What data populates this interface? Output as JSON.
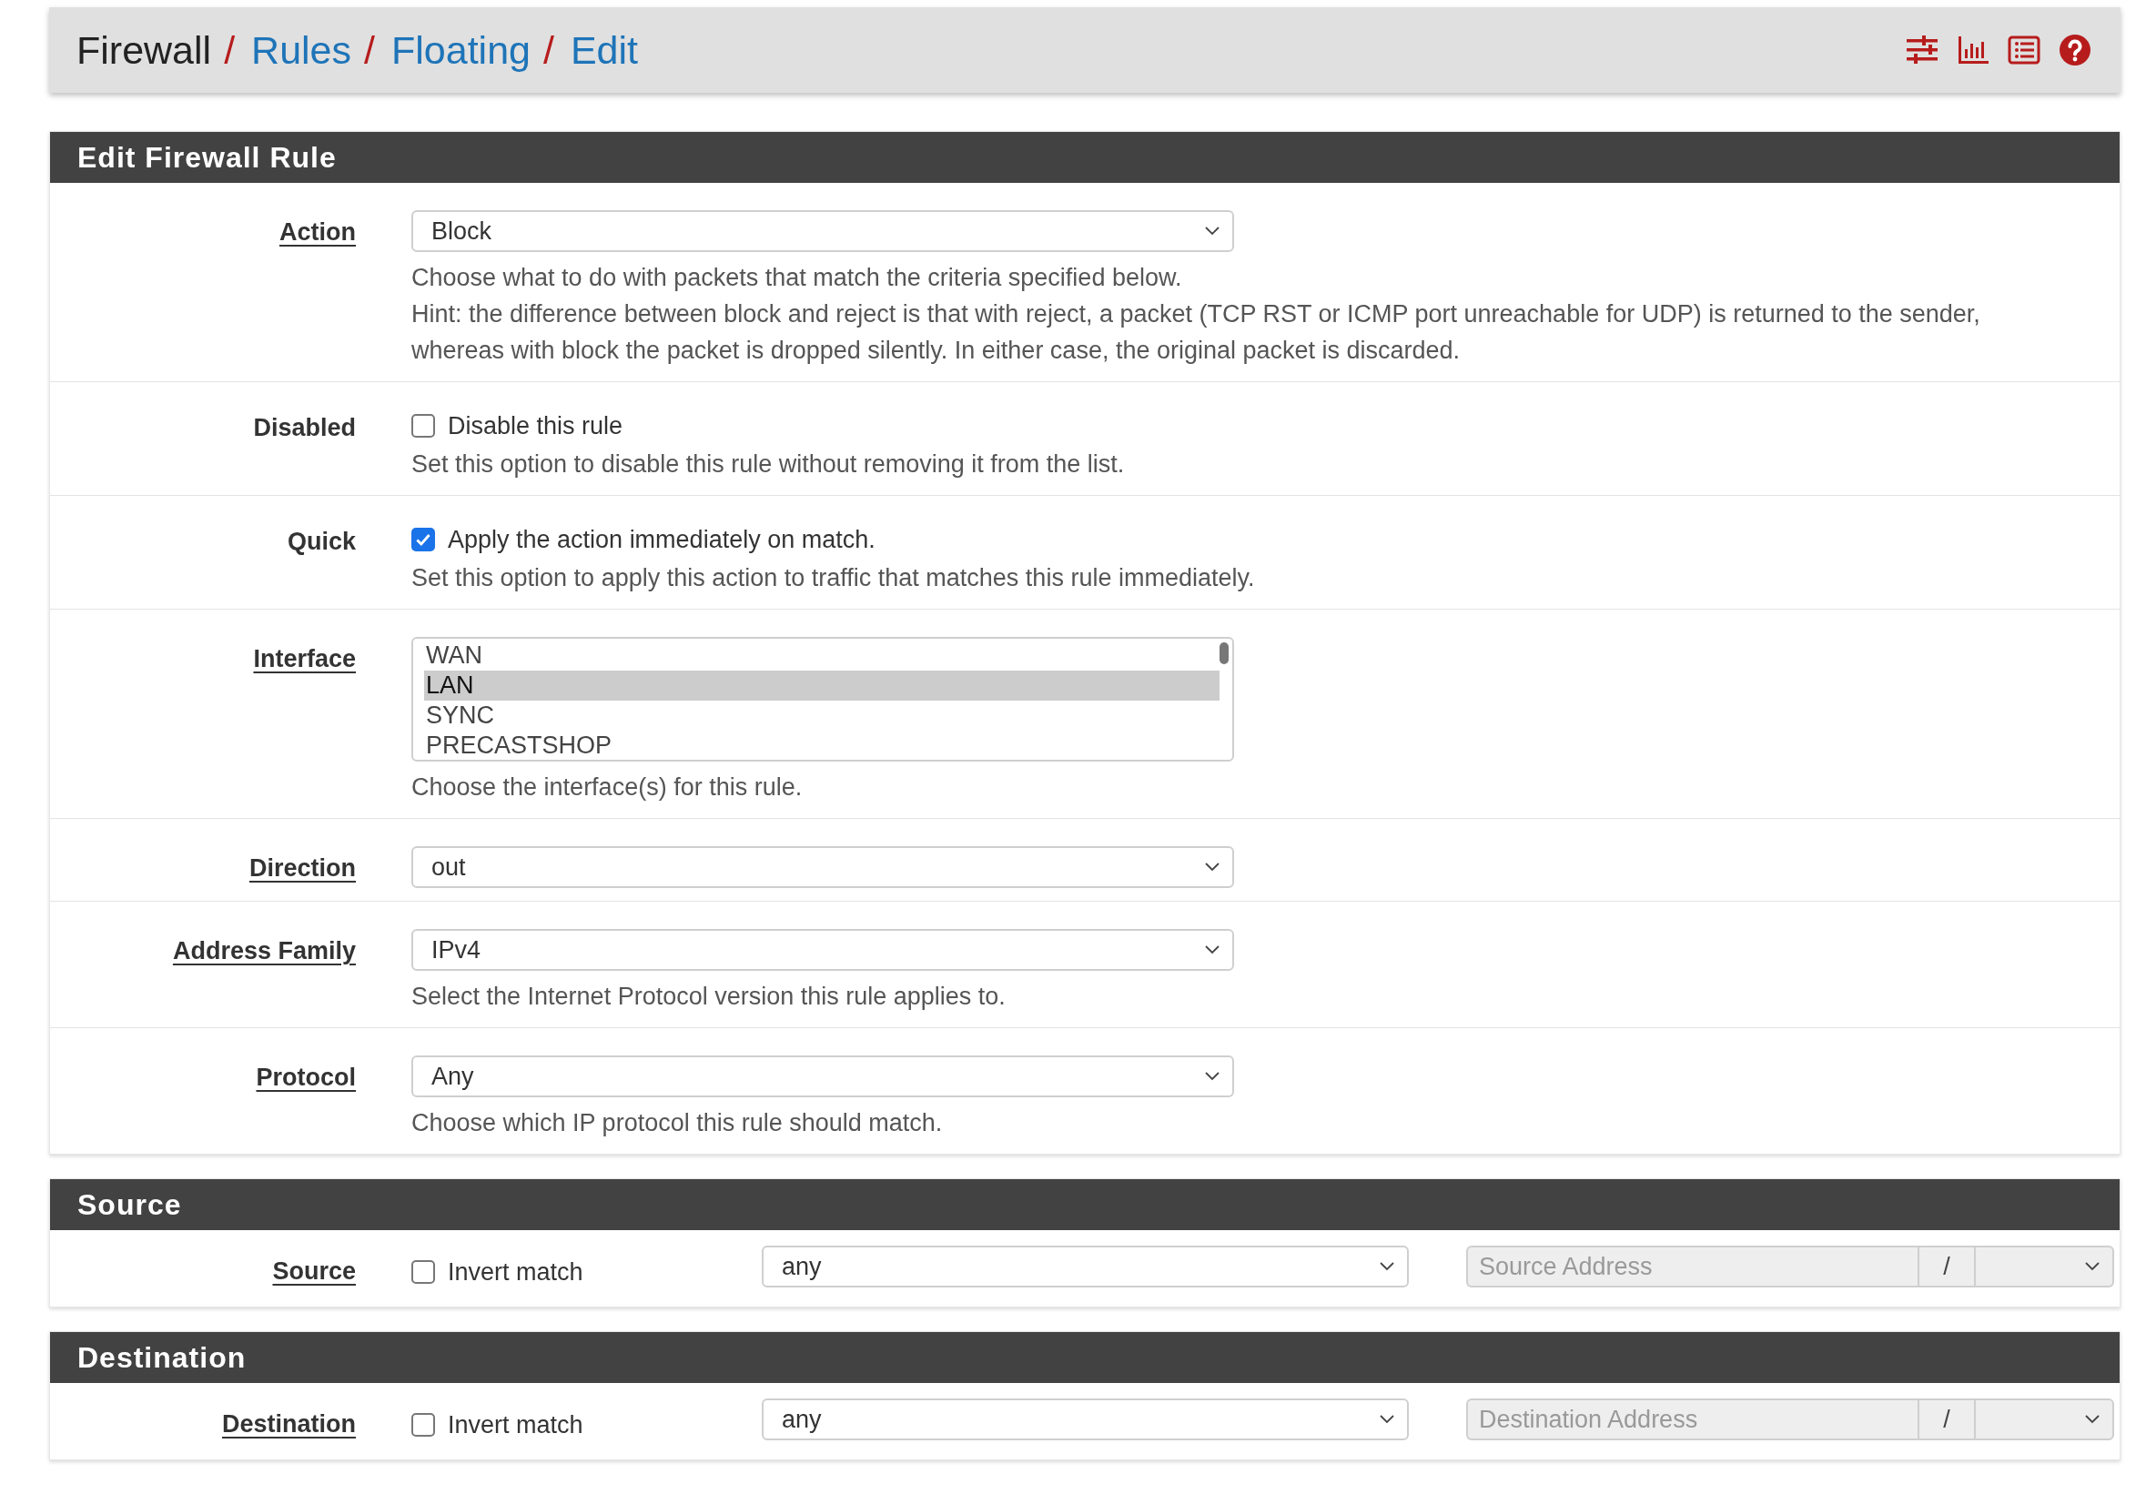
{
  "breadcrumb": [
    {
      "kind": "text",
      "text": "Firewall"
    },
    {
      "kind": "separator",
      "text": "/"
    },
    {
      "kind": "link",
      "text": "Rules"
    },
    {
      "kind": "separator",
      "text": "/"
    },
    {
      "kind": "link",
      "text": "Floating"
    },
    {
      "kind": "separator",
      "text": "/"
    },
    {
      "kind": "link",
      "text": "Edit"
    }
  ],
  "sections": [
    {
      "title": "Edit Firewall Rule",
      "rows": [
        {
          "kind": "select",
          "label": "Action",
          "link": true,
          "value": "Block",
          "help": [
            "Choose what to do with packets that match the criteria specified below.",
            "Hint: the difference between block and reject is that with reject, a packet (TCP RST or ICMP port unreachable for UDP) is returned to the sender, whereas with block the packet is dropped silently. In either case, the original packet is discarded."
          ]
        },
        {
          "kind": "checkbox",
          "label": "Disabled",
          "link": false,
          "checked": false,
          "text": "Disable this rule",
          "help": [
            "Set this option to disable this rule without removing it from the list."
          ]
        },
        {
          "kind": "checkbox",
          "label": "Quick",
          "link": false,
          "checked": true,
          "text": "Apply the action immediately on match.",
          "help": [
            "Set this option to apply this action to traffic that matches this rule immediately."
          ]
        },
        {
          "kind": "listbox",
          "label": "Interface",
          "link": true,
          "options": [
            {
              "label": "WAN",
              "selected": false
            },
            {
              "label": "LAN",
              "selected": true
            },
            {
              "label": "SYNC",
              "selected": false
            },
            {
              "label": "PRECASTSHOP",
              "selected": false
            }
          ],
          "help": [
            "Choose the interface(s) for this rule."
          ]
        },
        {
          "kind": "select",
          "label": "Direction",
          "link": true,
          "value": "out"
        },
        {
          "kind": "select",
          "label": "Address Family",
          "link": true,
          "value": "IPv4",
          "help": [
            "Select the Internet Protocol version this rule applies to."
          ]
        },
        {
          "kind": "select",
          "label": "Protocol",
          "link": true,
          "value": "Any",
          "help": [
            "Choose which IP protocol this rule should match."
          ]
        }
      ]
    },
    {
      "title": "Source",
      "rows": [
        {
          "kind": "address",
          "label": "Source",
          "link": true,
          "checked": false,
          "text": "Invert match",
          "value": "any",
          "placeholder": "Source Address",
          "slash": "/"
        }
      ]
    },
    {
      "title": "Destination",
      "rows": [
        {
          "kind": "address",
          "label": "Destination",
          "link": true,
          "checked": false,
          "text": "Invert match",
          "value": "any",
          "placeholder": "Destination Address",
          "slash": "/"
        }
      ]
    }
  ]
}
